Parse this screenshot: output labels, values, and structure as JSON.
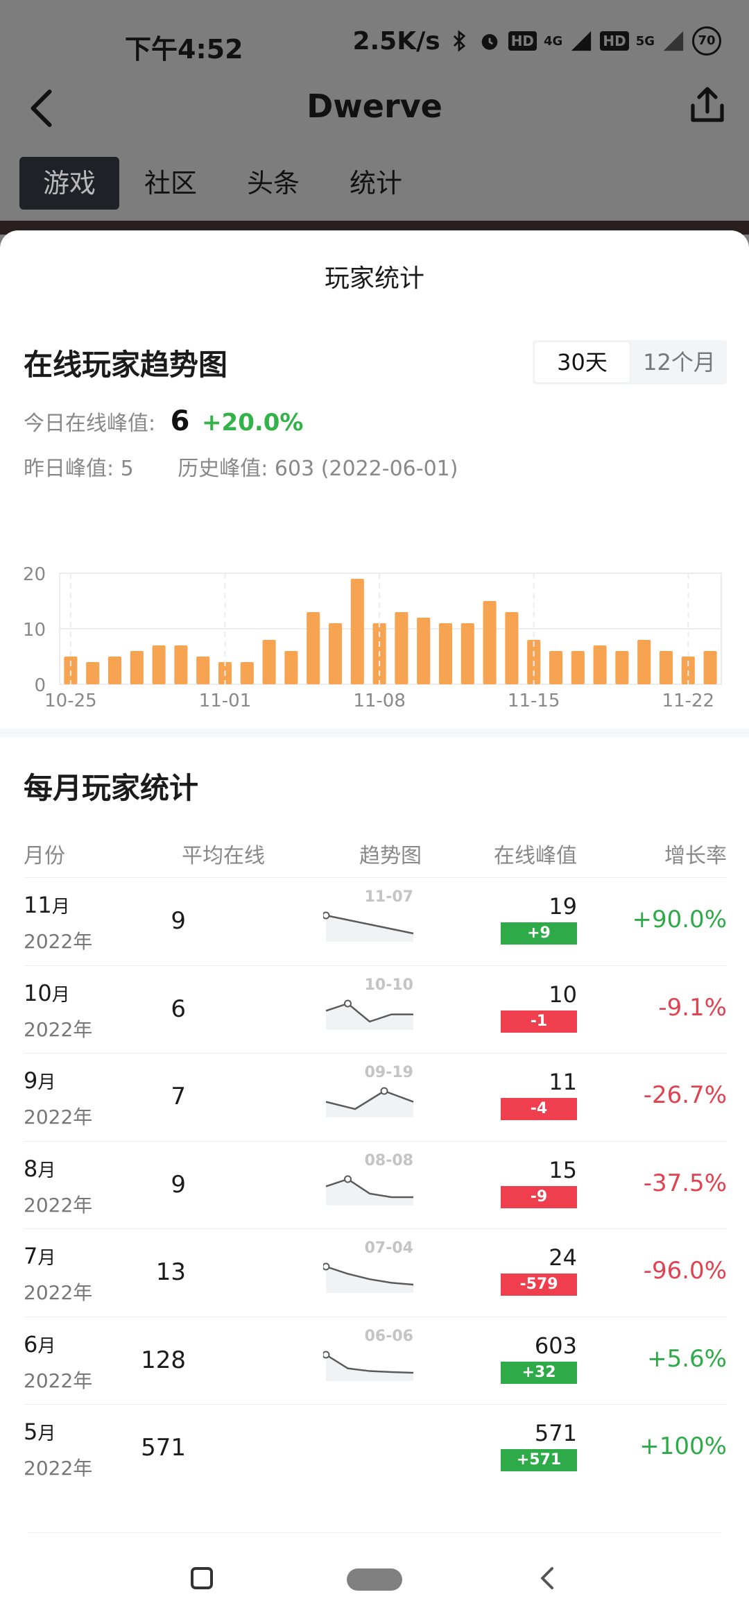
{
  "status": {
    "time": "下午4:52",
    "speed": "2.5K/s",
    "battery": "70",
    "net1": "4G",
    "net2": "5G",
    "hd": "HD"
  },
  "nav": {
    "title": "Dwerve"
  },
  "tabs": [
    "游戏",
    "社区",
    "头条",
    "统计"
  ],
  "sheet": {
    "title": "玩家统计",
    "trend_title": "在线玩家趋势图",
    "range_options": [
      "30天",
      "12个月"
    ],
    "today_label": "今日在线峰值:",
    "today_value": "6",
    "today_change": "+20.0%",
    "yesterday": "昨日峰值: 5",
    "history": "历史峰值: 603 (2022-06-01)",
    "monthly_title": "每月玩家统计",
    "headers": [
      "月份",
      "平均在线",
      "趋势图",
      "在线峰值",
      "增长率"
    ]
  },
  "chart_data": {
    "type": "bar",
    "categories": [
      "10-25",
      "10-26",
      "10-27",
      "10-28",
      "10-29",
      "10-30",
      "10-31",
      "11-01",
      "11-02",
      "11-03",
      "11-04",
      "11-05",
      "11-06",
      "11-07",
      "11-08",
      "11-09",
      "11-10",
      "11-11",
      "11-12",
      "11-13",
      "11-14",
      "11-15",
      "11-16",
      "11-17",
      "11-18",
      "11-19",
      "11-20",
      "11-21",
      "11-22",
      "11-23"
    ],
    "values": [
      5,
      4,
      5,
      6,
      7,
      7,
      5,
      4,
      4,
      8,
      6,
      13,
      11,
      19,
      11,
      13,
      12,
      11,
      11,
      15,
      13,
      8,
      6,
      6,
      7,
      6,
      8,
      6,
      5,
      6
    ],
    "x_tick_labels": [
      "10-25",
      "11-01",
      "11-08",
      "11-15",
      "11-22"
    ],
    "y_ticks": [
      0,
      10,
      20
    ],
    "ylim": [
      0,
      20
    ],
    "color": "#f7a452",
    "grid": true
  },
  "rows": [
    {
      "month": "11",
      "unit": "月",
      "year": "2022年",
      "avg": "9",
      "spark_label": "11-07",
      "spark": [
        19,
        14,
        9
      ],
      "peak": "19",
      "diff": "+9",
      "dir": "up",
      "rate": "+90.0%"
    },
    {
      "month": "10",
      "unit": "月",
      "year": "2022年",
      "avg": "6",
      "spark_label": "10-10",
      "spark": [
        8,
        10,
        5,
        7,
        7
      ],
      "peak": "10",
      "diff": "-1",
      "dir": "down",
      "rate": "-9.1%"
    },
    {
      "month": "9",
      "unit": "月",
      "year": "2022年",
      "avg": "7",
      "spark_label": "09-19",
      "spark": [
        8,
        6,
        11,
        8
      ],
      "peak": "11",
      "diff": "-4",
      "dir": "down",
      "rate": "-26.7%"
    },
    {
      "month": "8",
      "unit": "月",
      "year": "2022年",
      "avg": "9",
      "spark_label": "08-08",
      "spark": [
        13,
        15,
        11,
        10,
        10
      ],
      "peak": "15",
      "diff": "-9",
      "dir": "down",
      "rate": "-37.5%"
    },
    {
      "month": "7",
      "unit": "月",
      "year": "2022年",
      "avg": "13",
      "spark_label": "07-04",
      "spark": [
        24,
        20,
        17,
        15,
        14
      ],
      "peak": "24",
      "diff": "-579",
      "dir": "down",
      "rate": "-96.0%"
    },
    {
      "month": "6",
      "unit": "月",
      "year": "2022年",
      "avg": "128",
      "spark_label": "06-06",
      "spark": [
        603,
        200,
        120,
        90,
        70
      ],
      "peak": "603",
      "diff": "+32",
      "dir": "up",
      "rate": "+5.6%"
    },
    {
      "month": "5",
      "unit": "月",
      "year": "2022年",
      "avg": "571",
      "spark_label": "",
      "spark": [],
      "peak": "571",
      "diff": "+571",
      "dir": "up",
      "rate": "+100%"
    }
  ]
}
